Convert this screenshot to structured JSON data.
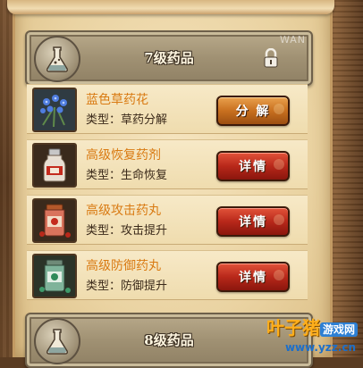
{
  "categories": [
    {
      "title": "7级药品",
      "badge": "WAN",
      "locked": true
    },
    {
      "title": "8级药品"
    }
  ],
  "items": [
    {
      "name": "蓝色草药花",
      "type": "类型：草药分解",
      "button": "分 解",
      "button_kind": "split",
      "icon": "blue-herb-flower-icon"
    },
    {
      "name": "高级恢复药剂",
      "type": "类型：生命恢复",
      "button": "详情",
      "button_kind": "detail",
      "icon": "recovery-potion-bottle-icon"
    },
    {
      "name": "高级攻击药丸",
      "type": "类型：攻击提升",
      "button": "详情",
      "button_kind": "detail",
      "icon": "attack-pill-jar-icon"
    },
    {
      "name": "高级防御药丸",
      "type": "类型：防御提升",
      "button": "详情",
      "button_kind": "detail",
      "icon": "defense-pill-jar-icon"
    }
  ],
  "watermark": {
    "brand_a": "叶子猪",
    "brand_b": "游戏网",
    "url": "www.yzz.cn"
  },
  "colors": {
    "item_name": "#d97a12",
    "split_button": "#c8701f",
    "detail_button": "#b8281a"
  }
}
